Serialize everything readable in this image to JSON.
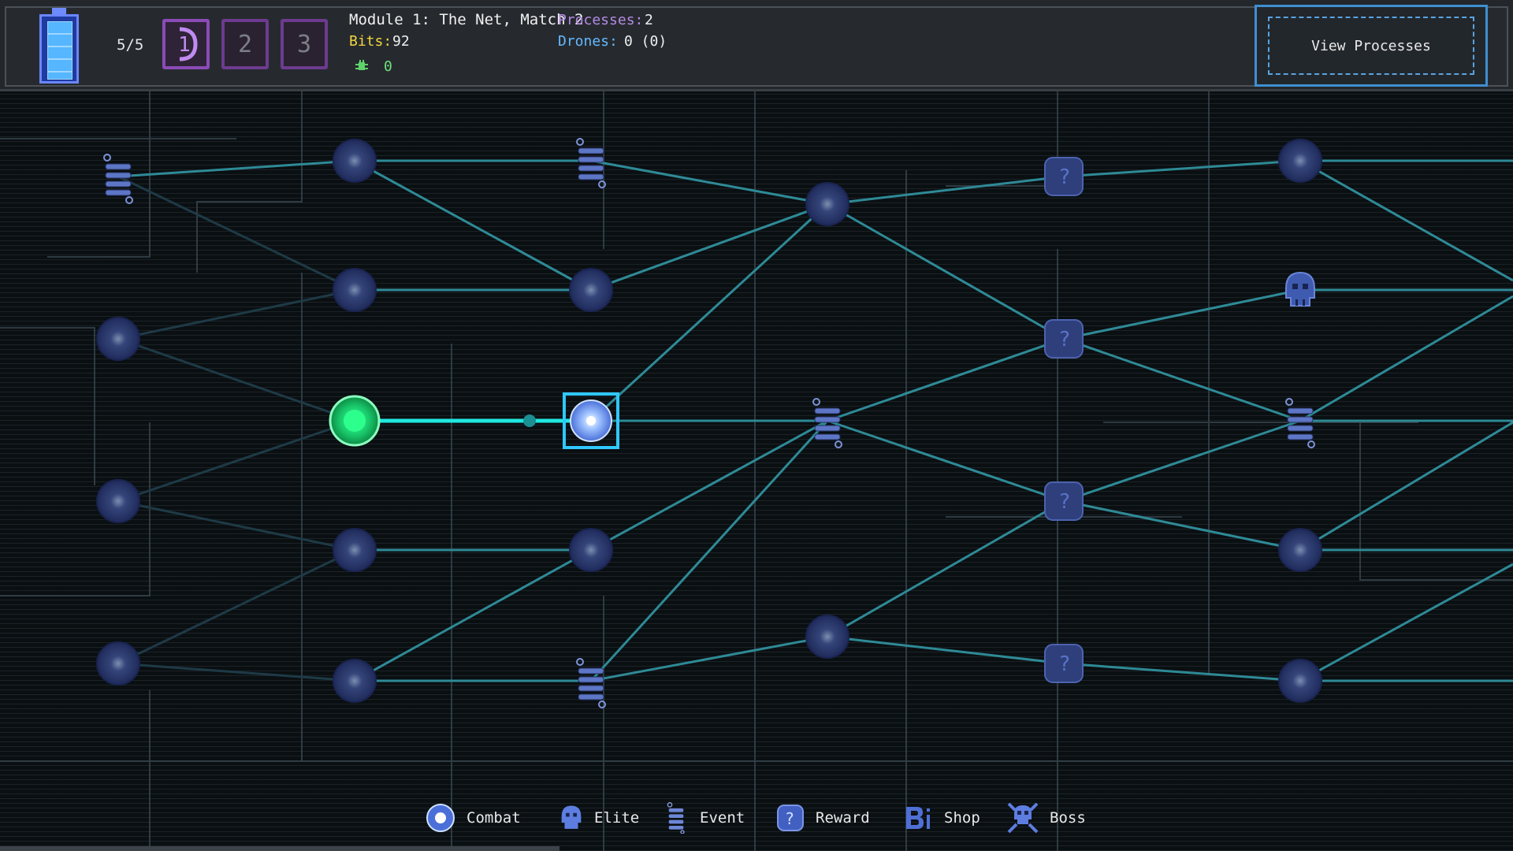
{
  "hud": {
    "energy": "5/5",
    "battery_level": 1.0,
    "slots": [
      {
        "label": "1",
        "filled": true
      },
      {
        "label": "2",
        "filled": false
      },
      {
        "label": "3",
        "filled": false
      }
    ],
    "title": "Module 1: The Net, Match 2",
    "bits_label": "Bits:",
    "bits_value": "92",
    "bugs_value": "0",
    "processes_label": "Processes:",
    "processes_value": "2",
    "drones_label": "Drones:",
    "drones_value": "0 (0)",
    "view_processes_label": "View Processes"
  },
  "colors": {
    "path": "#2e8a96",
    "path_dim": "#1f3f4d",
    "current_node": "#21e07c",
    "selected_outline": "#2fc8ff",
    "node_fill": "#2c3a78",
    "accent_purple": "#8b4bb7"
  },
  "legend": [
    {
      "icon": "combat-icon",
      "label": "Combat"
    },
    {
      "icon": "elite-icon",
      "label": "Elite"
    },
    {
      "icon": "event-icon",
      "label": "Event"
    },
    {
      "icon": "reward-icon",
      "label": "Reward"
    },
    {
      "icon": "shop-icon",
      "label": "Shop"
    },
    {
      "icon": "boss-icon",
      "label": "Boss"
    }
  ]
}
